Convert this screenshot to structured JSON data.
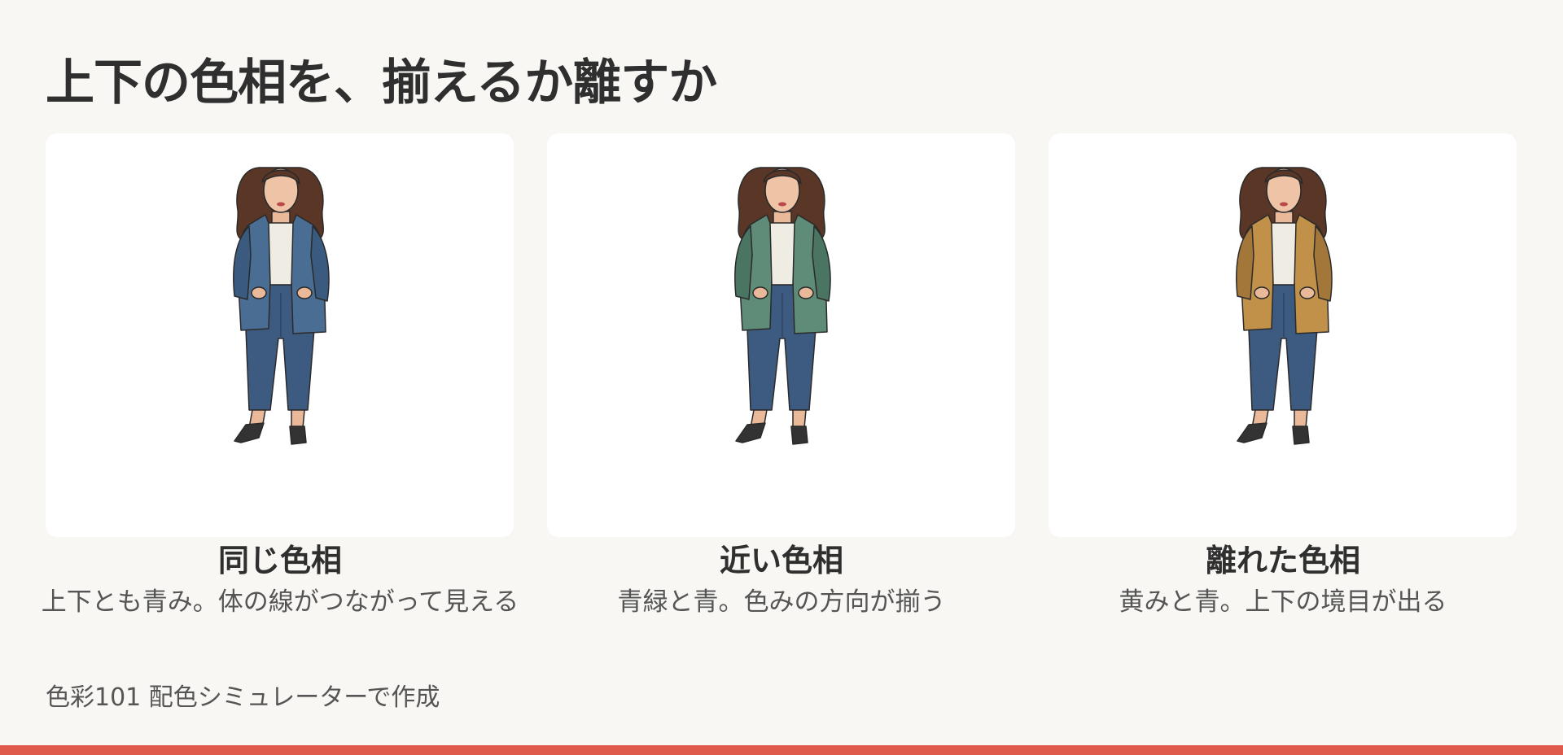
{
  "page": {
    "title": "上下の色相を、揃えるか離すか",
    "footer": "色彩101 配色シミュレーターで作成",
    "accent_color": "#e05a4b"
  },
  "cards": [
    {
      "caption_title": "同じ色相",
      "caption_desc": "上下とも青み。体の線がつながって見える",
      "coat_color": "#4a6d94",
      "coat_shade": "#3a5a80",
      "pants_color": "#3d5a80"
    },
    {
      "caption_title": "近い色相",
      "caption_desc": "青緑と青。色みの方向が揃う",
      "coat_color": "#5e8c78",
      "coat_shade": "#4b7563",
      "pants_color": "#3d5a80"
    },
    {
      "caption_title": "離れた色相",
      "caption_desc": "黄みと青。上下の境目が出る",
      "coat_color": "#c1914a",
      "coat_shade": "#a3773a",
      "pants_color": "#3d5a80"
    }
  ]
}
